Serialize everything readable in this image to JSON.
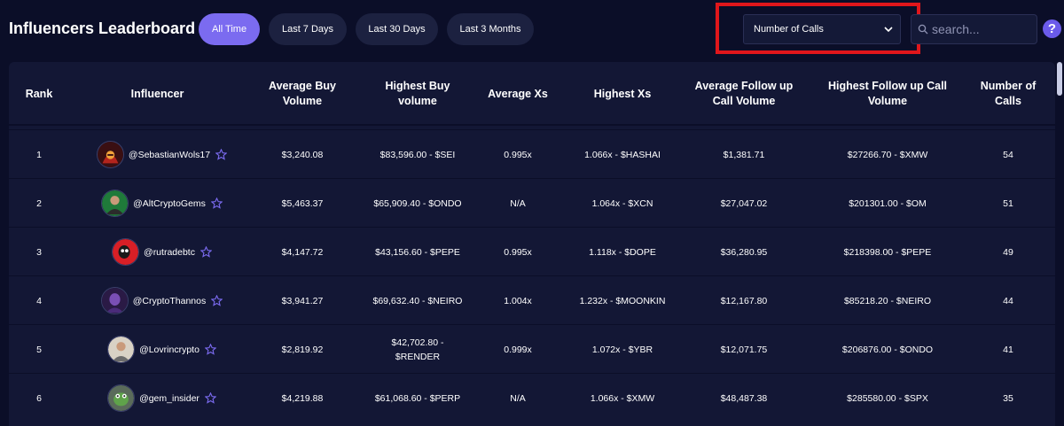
{
  "header": {
    "title": "Influencers Leaderboard",
    "tabs": [
      {
        "label": "All Time",
        "active": true
      },
      {
        "label": "Last 7 Days",
        "active": false
      },
      {
        "label": "Last 30 Days",
        "active": false
      },
      {
        "label": "Last 3 Months",
        "active": false
      }
    ],
    "sort_select": {
      "value": "Number of Calls"
    },
    "search": {
      "placeholder": "search..."
    },
    "help_label": "?"
  },
  "colors": {
    "background": "#0b0e28",
    "panel": "#131735",
    "accent": "#7b6bf0",
    "tab_inactive": "#1c2140",
    "highlight": "#e0161b",
    "star": "#7b6bf0"
  },
  "table": {
    "columns": [
      "Rank",
      "Influencer",
      "Average Buy Volume",
      "Highest Buy volume",
      "Average Xs",
      "Highest Xs",
      "Average Follow up Call Volume",
      "Highest Follow up Call Volume",
      "Number of Calls"
    ],
    "rows": [
      {
        "rank": "1",
        "handle": "@SebastianWols17",
        "avatar": "red-hood-avatar",
        "avg_buy": "$3,240.08",
        "highest_buy": "$83,596.00 - $SEI",
        "avg_xs": "0.995x",
        "highest_xs": "1.066x - $HASHAI",
        "avg_follow": "$1,381.71",
        "highest_follow": "$27266.70 - $XMW",
        "calls": "54"
      },
      {
        "rank": "2",
        "handle": "@AltCryptoGems",
        "avatar": "man-green-avatar",
        "avg_buy": "$5,463.37",
        "highest_buy": "$65,909.40 - $ONDO",
        "avg_xs": "N/A",
        "highest_xs": "1.064x - $XCN",
        "avg_follow": "$27,047.02",
        "highest_follow": "$201301.00 - $OM",
        "calls": "51"
      },
      {
        "rank": "3",
        "handle": "@rutradebtc",
        "avatar": "red-mask-avatar",
        "avg_buy": "$4,147.72",
        "highest_buy": "$43,156.60 - $PEPE",
        "avg_xs": "0.995x",
        "highest_xs": "1.118x - $DOPE",
        "avg_follow": "$36,280.95",
        "highest_follow": "$218398.00 - $PEPE",
        "calls": "49"
      },
      {
        "rank": "4",
        "handle": "@CryptoThannos",
        "avatar": "purple-titan-avatar",
        "avg_buy": "$3,941.27",
        "highest_buy": "$69,632.40 - $NEIRO",
        "avg_xs": "1.004x",
        "highest_xs": "1.232x - $MOONKIN",
        "avg_follow": "$12,167.80",
        "highest_follow": "$85218.20 - $NEIRO",
        "calls": "44"
      },
      {
        "rank": "5",
        "handle": "@Lovrincrypto",
        "avatar": "man-portrait-avatar",
        "avg_buy": "$2,819.92",
        "highest_buy": "$42,702.80 - $RENDER",
        "avg_xs": "0.999x",
        "highest_xs": "1.072x - $YBR",
        "avg_follow": "$12,071.75",
        "highest_follow": "$206876.00 - $ONDO",
        "calls": "41"
      },
      {
        "rank": "6",
        "handle": "@gem_insider",
        "avatar": "pepe-avatar",
        "avg_buy": "$4,219.88",
        "highest_buy": "$61,068.60 - $PERP",
        "avg_xs": "N/A",
        "highest_xs": "1.066x - $XMW",
        "avg_follow": "$48,487.38",
        "highest_follow": "$285580.00 - $SPX",
        "calls": "35"
      }
    ]
  }
}
